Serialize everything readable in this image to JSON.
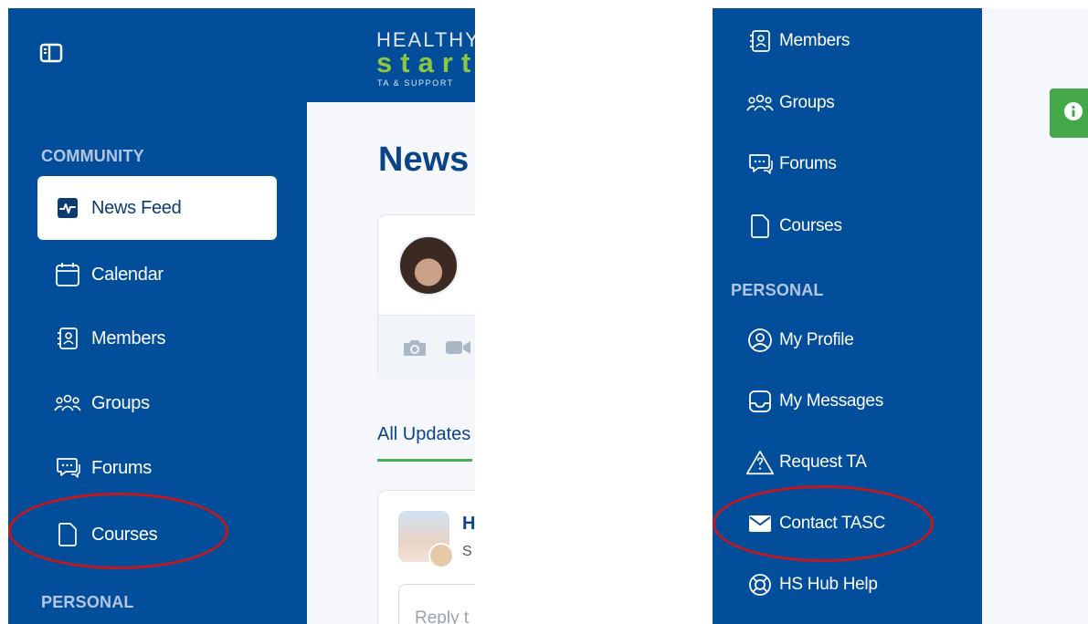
{
  "left_screen": {
    "logo": {
      "line1": "HEALTHY",
      "line2": "start",
      "line3": "TA & SUPPORT"
    },
    "section_community": "COMMUNITY",
    "section_personal": "PERSONAL",
    "nav": [
      {
        "label": "News Feed",
        "icon": "activity-icon",
        "active": true
      },
      {
        "label": "Calendar",
        "icon": "calendar-icon",
        "active": false
      },
      {
        "label": "Members",
        "icon": "contact-book-icon",
        "active": false
      },
      {
        "label": "Groups",
        "icon": "groups-icon",
        "active": false
      },
      {
        "label": "Forums",
        "icon": "forum-chat-icon",
        "active": false
      },
      {
        "label": "Courses",
        "icon": "document-icon",
        "active": false
      }
    ],
    "page_title": "News",
    "tab_label": "All Updates",
    "feed_card": {
      "name_initial": "H",
      "sub_initial": "S",
      "reply_placeholder": "Reply t"
    },
    "composer_icons": [
      "camera-icon",
      "video-icon"
    ]
  },
  "right_screen": {
    "section_personal": "PERSONAL",
    "nav": [
      {
        "label": "Members",
        "icon": "contact-book-icon"
      },
      {
        "label": "Groups",
        "icon": "groups-icon"
      },
      {
        "label": "Forums",
        "icon": "forum-chat-icon"
      },
      {
        "label": "Courses",
        "icon": "document-icon"
      }
    ],
    "personal_nav": [
      {
        "label": "My Profile",
        "icon": "user-circle-icon"
      },
      {
        "label": "My Messages",
        "icon": "inbox-icon"
      },
      {
        "label": "Request TA",
        "icon": "warning-question-icon"
      },
      {
        "label": "Contact TASC",
        "icon": "envelope-icon"
      },
      {
        "label": "HS Hub Help",
        "icon": "lifebuoy-icon"
      }
    ],
    "info_button_icon": "info-icon"
  },
  "colors": {
    "sidebar_blue": "#024e9b",
    "logo_green": "#8dc63f",
    "annotation_red": "#c0181f",
    "info_green": "#43a948",
    "title_blue": "#0a4487"
  }
}
